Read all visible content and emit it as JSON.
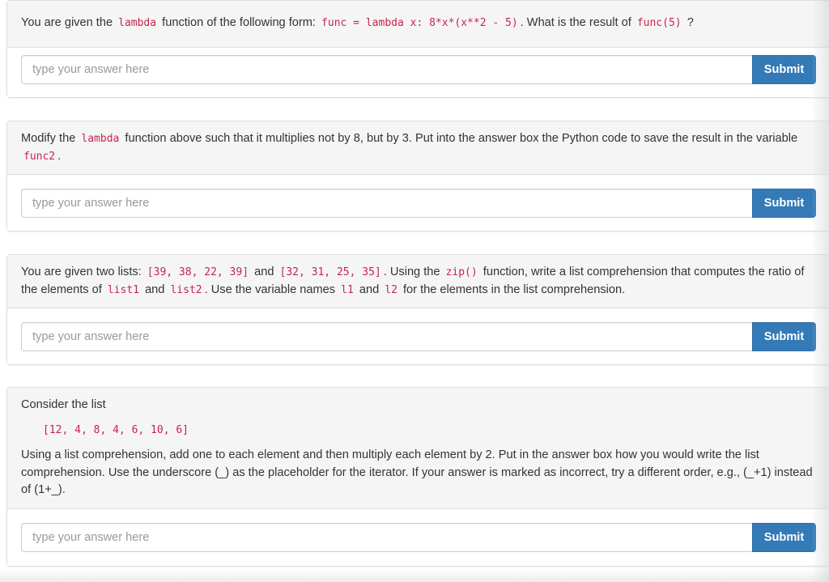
{
  "questions": [
    {
      "prompt": {
        "t1": "You are given the",
        "c1": "lambda",
        "t2": "function of the following form:",
        "c2": "func = lambda x: 8*x*(x**2 - 5)",
        "t3": ". What is the result of",
        "c3": "func(5)",
        "t4": "?"
      },
      "placeholder": "type your answer here",
      "submit_label": "Submit"
    },
    {
      "prompt": {
        "t1": "Modify the",
        "c1": "lambda",
        "t2": "function above such that it multiplies not by 8, but by 3. Put into the answer box the Python code to save the result in the variable",
        "c2": "func2",
        "t3": "."
      },
      "placeholder": "type your answer here",
      "submit_label": "Submit"
    },
    {
      "prompt": {
        "t1": "You are given two lists:",
        "c1": "[39, 38, 22, 39]",
        "t2": "and",
        "c2": "[32, 31, 25, 35]",
        "t3": ". Using the",
        "c3": "zip()",
        "t4": "function, write a list comprehension that computes the ratio of the elements of",
        "c4": "list1",
        "t5": "and",
        "c5": "list2",
        "t6": ". Use the variable names",
        "c6": "l1",
        "t7": "and",
        "c7": "l2",
        "t8": "for the elements in the list comprehension."
      },
      "placeholder": "type your answer here",
      "submit_label": "Submit"
    },
    {
      "prompt": {
        "intro": "Consider the list",
        "code": "[12, 4, 8, 4, 6, 10, 6]",
        "body": "Using a list comprehension, add one to each element and then multiply each element by 2. Put in the answer box how you would write the list comprehension. Use the underscore (_) as the placeholder for the iterator. If your answer is marked as incorrect, try a different order, e.g., (_+1) instead of (1+_)."
      },
      "placeholder": "type your answer here",
      "submit_label": "Submit"
    }
  ],
  "colors": {
    "code_text": "#c7254e",
    "submit_bg": "#337ab7",
    "panel_heading_bg": "#f5f5f5",
    "border": "#dddddd"
  }
}
